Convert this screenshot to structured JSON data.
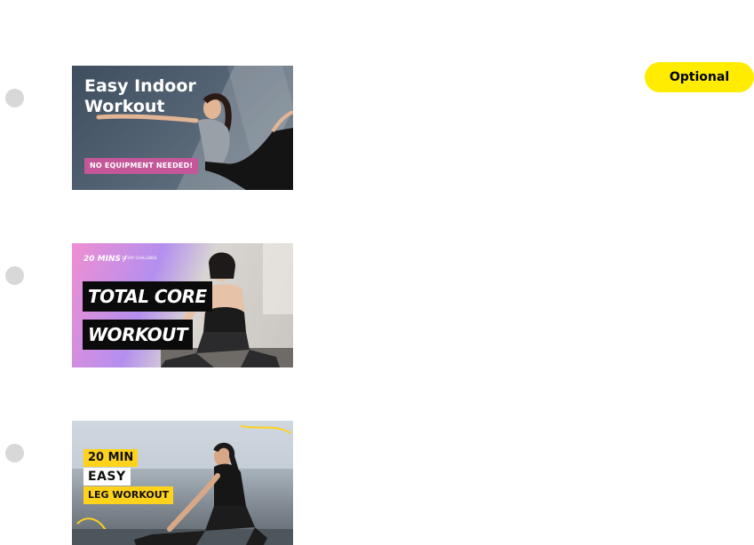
{
  "badge": {
    "label": "Optional"
  },
  "colors": {
    "badge": "#ffec00",
    "radio": "#d8d8d8"
  },
  "options": [
    {
      "thumbnail": {
        "title": "Easy Indoor Workout",
        "subtitle": "NO EQUIPMENT NEEDED!"
      }
    },
    {
      "thumbnail": {
        "kicker": "20 MINS /",
        "challenge": "28 DAY CHALLENGE",
        "line1": "TOTAL CORE",
        "line2": "WORKOUT"
      }
    },
    {
      "thumbnail": {
        "line1": "20 MIN",
        "line2": "EASY",
        "line3": "LEG WORKOUT"
      }
    }
  ]
}
